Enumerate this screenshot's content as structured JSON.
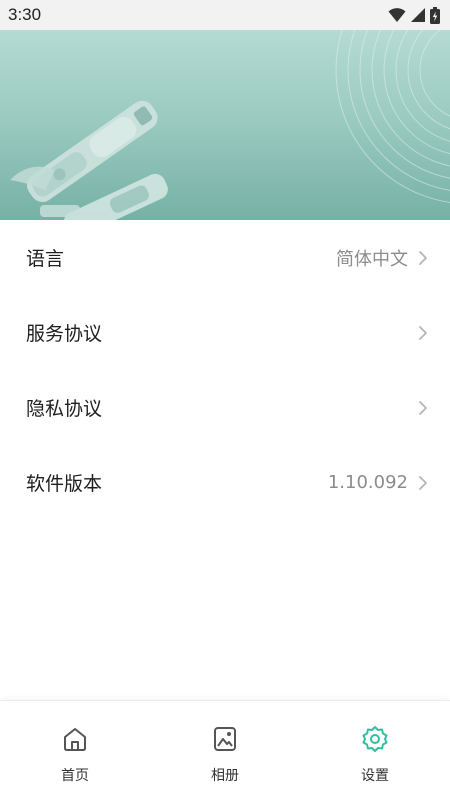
{
  "status_bar": {
    "time": "3:30",
    "icons": [
      "wifi-icon",
      "signal-icon",
      "battery-charging-icon"
    ]
  },
  "banner": {
    "image": "vacuum-product-banner",
    "colors": {
      "top": "#b4dbd3",
      "bottom": "#76b1a6"
    }
  },
  "settings": {
    "items": [
      {
        "label": "语言",
        "value": "简体中文"
      },
      {
        "label": "服务协议",
        "value": ""
      },
      {
        "label": "隐私协议",
        "value": ""
      },
      {
        "label": "软件版本",
        "value": "1.10.092"
      }
    ]
  },
  "bottom_nav": {
    "active_color": "#2fbf9f",
    "items": [
      {
        "label": "首页",
        "icon": "home-icon",
        "active": false
      },
      {
        "label": "相册",
        "icon": "gallery-icon",
        "active": false
      },
      {
        "label": "设置",
        "icon": "settings-gear-icon",
        "active": true
      }
    ]
  }
}
